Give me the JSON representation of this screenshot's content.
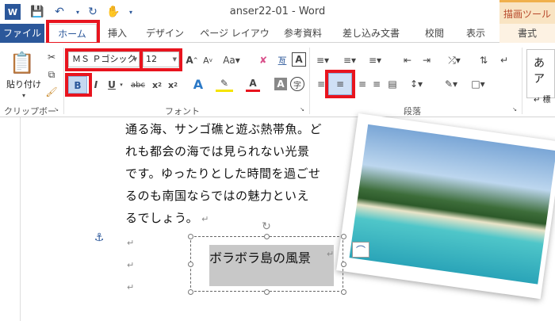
{
  "window": {
    "title": "anser22-01 - Word",
    "contextual_tab_label": "描画ツール"
  },
  "tabs": [
    {
      "label": "ファイル"
    },
    {
      "label": "ホーム"
    },
    {
      "label": "挿入"
    },
    {
      "label": "デザイン"
    },
    {
      "label": "ページ レイアウト"
    },
    {
      "label": "参考資料"
    },
    {
      "label": "差し込み文書"
    },
    {
      "label": "校閲"
    },
    {
      "label": "表示"
    },
    {
      "label": "書式"
    }
  ],
  "ribbon": {
    "clipboard": {
      "label": "クリップボード",
      "paste_label": "貼り付け"
    },
    "font": {
      "label": "フォント",
      "font_name": "ＭＳ Ｐゴシック",
      "font_size": "12"
    },
    "paragraph": {
      "label": "段落"
    },
    "styles": {
      "preview_text": "あア",
      "preview_text2": "↵ 標"
    }
  },
  "document": {
    "lines": [
      "通る海、サンゴ礁と遊ぶ熱帯魚。ど",
      "れも都会の海では見られない光景",
      "です。ゆったりとした時間を過ごせ",
      "るのも南国ならではの魅力といえ",
      "るでしょう。"
    ],
    "paragraph_mark": "↵",
    "textbox_text": "ボラボラ島の風景"
  },
  "colors": {
    "accent": "#2b579a",
    "highlight": "#e8141e",
    "tab_context": "#b7472a"
  }
}
